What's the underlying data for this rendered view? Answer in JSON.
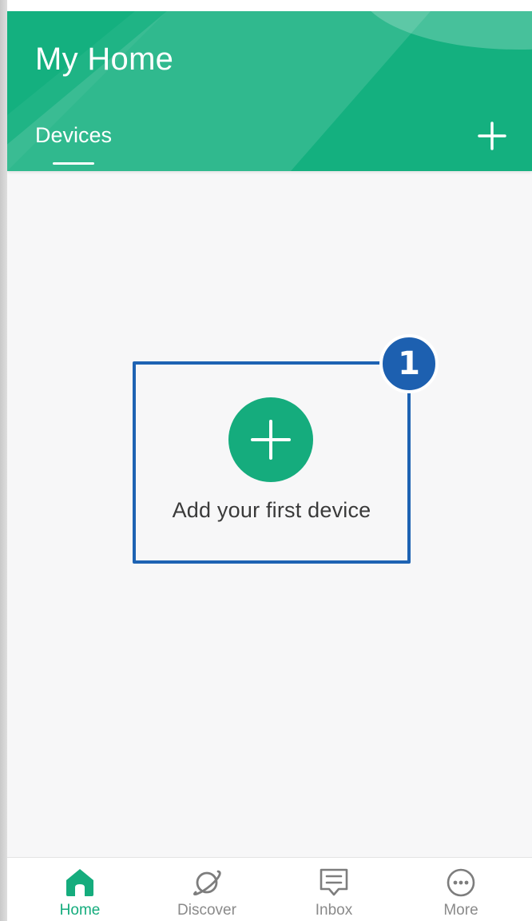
{
  "colors": {
    "brand_green": "#14b07f",
    "button_green": "#15ac7d",
    "callout_blue": "#1e63b3",
    "inactive_nav": "#8a8a8a",
    "background": "#f7f7f8"
  },
  "header": {
    "title": "My Home",
    "tabs": [
      {
        "label": "Devices",
        "active": true
      }
    ],
    "add_icon": "plus-icon"
  },
  "main": {
    "empty_state": {
      "add_icon": "plus-icon",
      "label": "Add your first device"
    },
    "callout": {
      "number": "1"
    }
  },
  "bottom_nav": {
    "items": [
      {
        "label": "Home",
        "icon": "home-icon",
        "active": true
      },
      {
        "label": "Discover",
        "icon": "planet-icon",
        "active": false
      },
      {
        "label": "Inbox",
        "icon": "message-icon",
        "active": false
      },
      {
        "label": "More",
        "icon": "more-dots-icon",
        "active": false
      }
    ]
  }
}
